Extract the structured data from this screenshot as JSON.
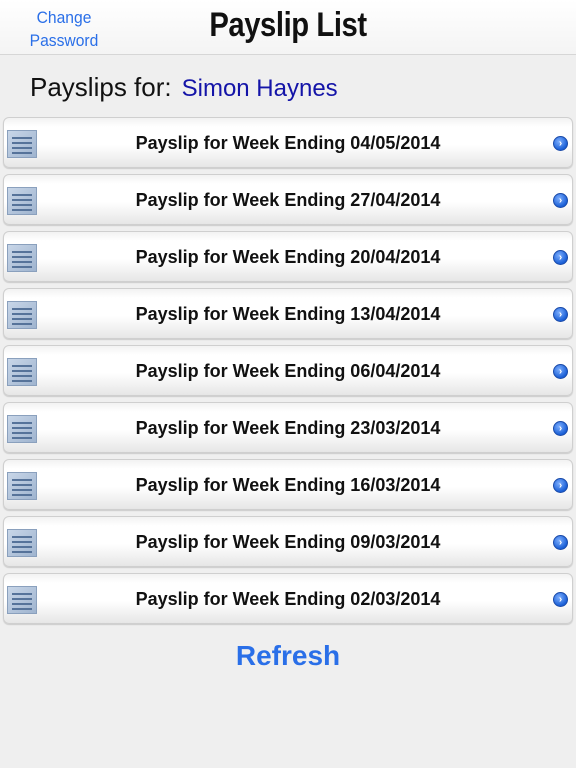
{
  "navbar": {
    "change_password_line1": "Change",
    "change_password_line2": "Password",
    "title": "Payslip List"
  },
  "employee": {
    "label": "Payslips for:",
    "name": "Simon Haynes"
  },
  "payslips": [
    {
      "label": "Payslip for Week Ending 04/05/2014",
      "icon": "document-thumbnail-icon",
      "accessory": "chevron-right-icon"
    },
    {
      "label": "Payslip for Week Ending 27/04/2014",
      "icon": "document-thumbnail-icon",
      "accessory": "chevron-right-icon"
    },
    {
      "label": "Payslip for Week Ending 20/04/2014",
      "icon": "document-thumbnail-icon",
      "accessory": "chevron-right-icon"
    },
    {
      "label": "Payslip for Week Ending 13/04/2014",
      "icon": "document-thumbnail-icon",
      "accessory": "chevron-right-icon"
    },
    {
      "label": "Payslip for Week Ending 06/04/2014",
      "icon": "document-thumbnail-icon",
      "accessory": "chevron-right-icon"
    },
    {
      "label": "Payslip for Week Ending 23/03/2014",
      "icon": "document-thumbnail-icon",
      "accessory": "chevron-right-icon"
    },
    {
      "label": "Payslip for Week Ending 16/03/2014",
      "icon": "document-thumbnail-icon",
      "accessory": "chevron-right-icon"
    },
    {
      "label": "Payslip for Week Ending 09/03/2014",
      "icon": "document-thumbnail-icon",
      "accessory": "chevron-right-icon"
    },
    {
      "label": "Payslip for Week Ending 02/03/2014",
      "icon": "document-thumbnail-icon",
      "accessory": "chevron-right-icon"
    }
  ],
  "refresh_label": "Refresh",
  "colors": {
    "link_blue": "#2a6fe8",
    "name_blue": "#1414a8",
    "background": "#efefef"
  }
}
